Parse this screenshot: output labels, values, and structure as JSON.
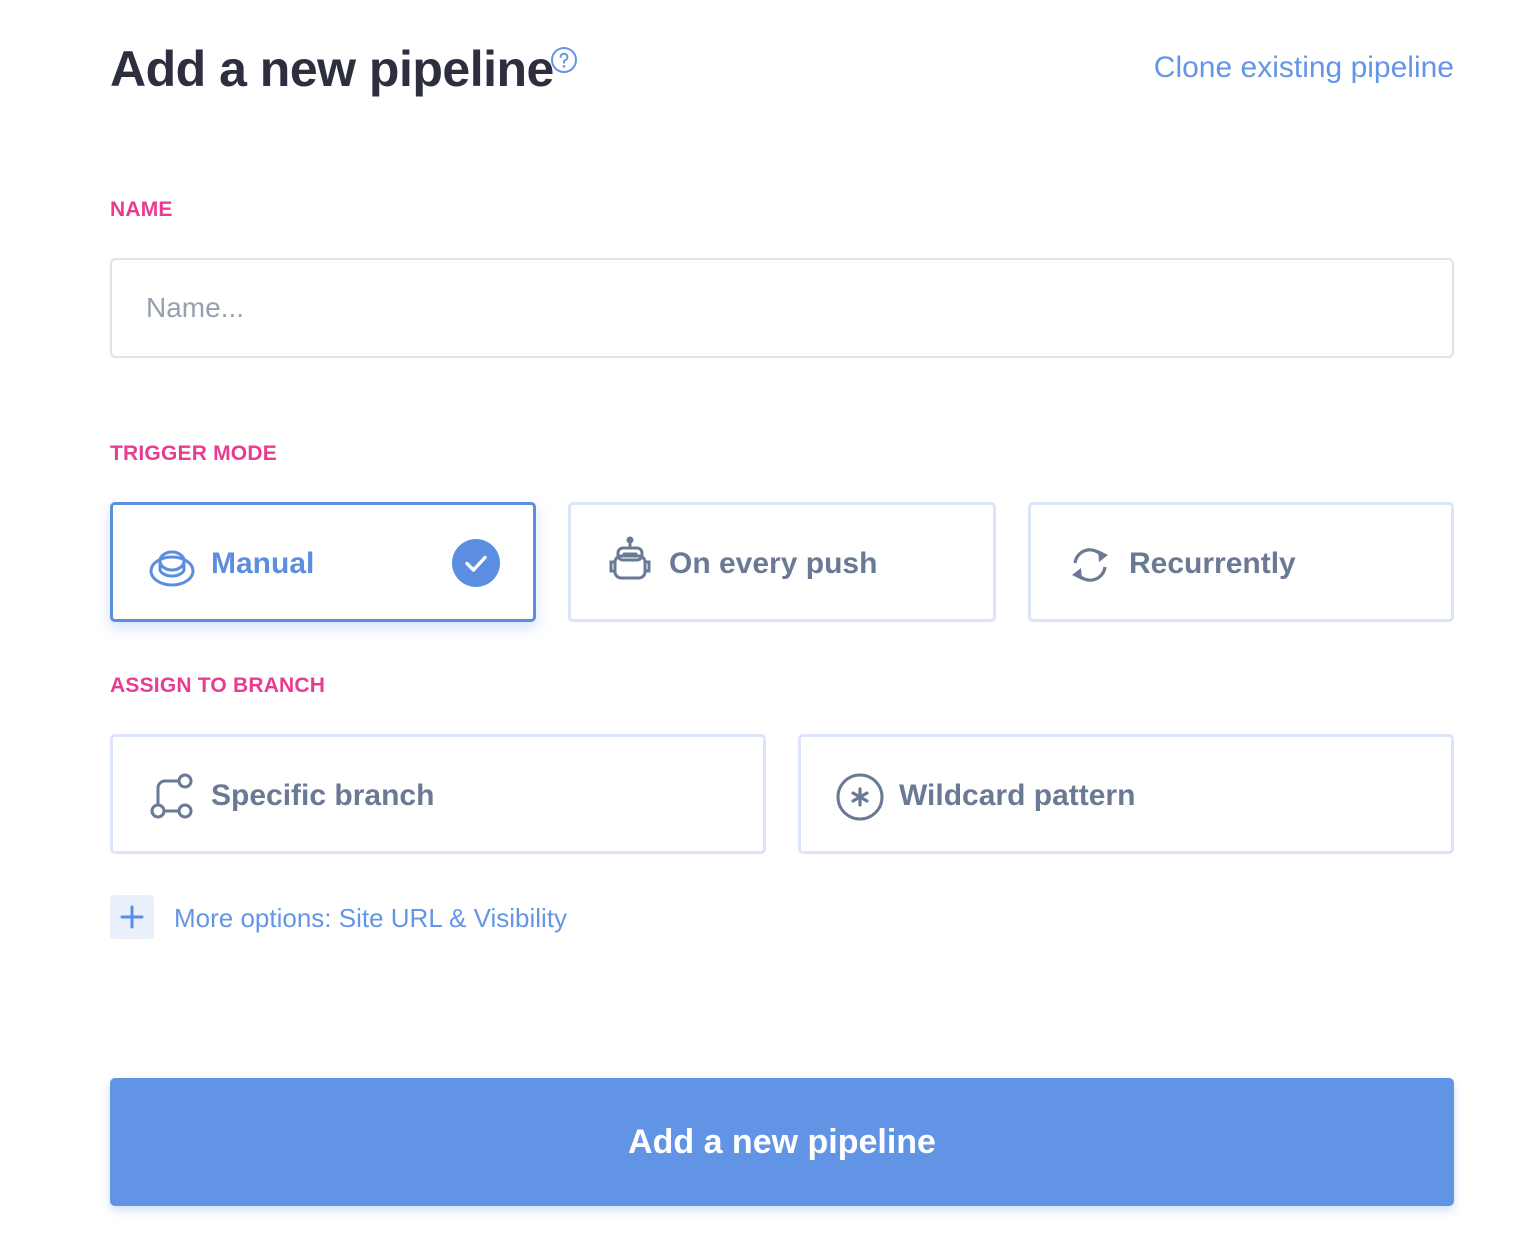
{
  "header": {
    "title": "Add a new pipeline",
    "help_icon": "question-circle-icon",
    "clone_link": "Clone existing pipeline"
  },
  "name_section": {
    "label": "NAME",
    "placeholder": "Name...",
    "value": ""
  },
  "trigger_section": {
    "label": "TRIGGER MODE",
    "options": [
      {
        "label": "Manual",
        "icon": "hand-press-icon",
        "selected": true
      },
      {
        "label": "On every push",
        "icon": "robot-icon",
        "selected": false
      },
      {
        "label": "Recurrently",
        "icon": "refresh-cycle-icon",
        "selected": false
      }
    ]
  },
  "branch_section": {
    "label": "ASSIGN TO BRANCH",
    "options": [
      {
        "label": "Specific branch",
        "icon": "git-branch-icon",
        "selected": false
      },
      {
        "label": "Wildcard pattern",
        "icon": "asterisk-circle-icon",
        "selected": false
      }
    ]
  },
  "more_options": {
    "icon": "plus-icon",
    "label": "More options: Site URL & Visibility"
  },
  "submit": {
    "label": "Add a new pipeline"
  },
  "colors": {
    "accent": "#6194e5",
    "section_label": "#e83c91",
    "title": "#2d2f3e",
    "option_text": "#6b7a94",
    "option_border": "#dbe5f8"
  }
}
